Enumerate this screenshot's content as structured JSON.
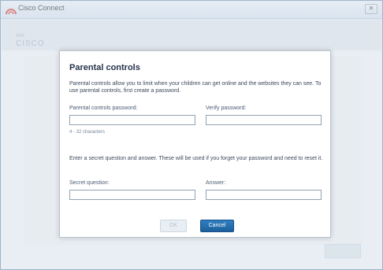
{
  "window": {
    "title": "Cisco Connect",
    "close_symbol": "✕"
  },
  "logo": {
    "bars": "ılıılı",
    "text": "CISCO"
  },
  "dialog": {
    "title": "Parental controls",
    "description": "Parental controls allow you to limit when your children can get online and the websites they can see. To use parental controls, first create a password.",
    "password_label": "Parental controls password:",
    "verify_label": "Verify password:",
    "password_hint": "4 - 32 characters",
    "secret_desc": "Enter a secret question and answer. These will be used if you forget your password and need to reset it.",
    "question_label": "Secret question:",
    "answer_label": "Answer:",
    "password_value": "",
    "verify_value": "",
    "question_value": "",
    "answer_value": "",
    "ok_label": "OK",
    "cancel_label": "Cancel"
  },
  "colors": {
    "accent": "#1d5f9c",
    "title": "#25334b"
  },
  "icons": {
    "app": "cisco-connect-icon",
    "close": "close-icon"
  }
}
